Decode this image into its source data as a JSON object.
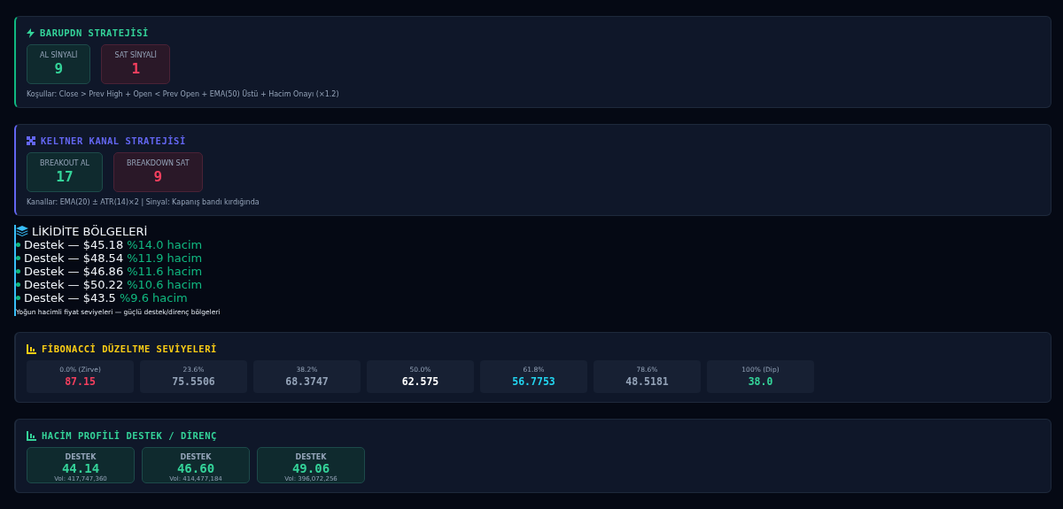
{
  "barupdn": {
    "title": "BARUPDN STRATEJİSİ",
    "signals": [
      {
        "kind": "buy",
        "label": "AL SİNYALİ",
        "value": "9"
      },
      {
        "kind": "sell",
        "label": "SAT SİNYALİ",
        "value": "1"
      }
    ],
    "note": "Koşullar: Close > Prev High + Open < Prev Open + EMA(50) Üstü + Hacim Onayı (×1.2)"
  },
  "keltner": {
    "title": "KELTNER KANAL STRATEJİSİ",
    "signals": [
      {
        "kind": "buy",
        "label": "BREAKOUT AL",
        "value": "17"
      },
      {
        "kind": "sell",
        "label": "BREAKDOWN SAT",
        "value": "9"
      }
    ],
    "note": "Kanallar: EMA(20) ± ATR(14)×2 | Sinyal: Kapanış bandı kırdığında"
  },
  "liquidity": {
    "title": "LİKİDİTE BÖLGELERİ",
    "zones": [
      {
        "label": "Destek — $45.18",
        "share": "%14.0 hacim"
      },
      {
        "label": "Destek — $48.54",
        "share": "%11.9 hacim"
      },
      {
        "label": "Destek — $46.86",
        "share": "%11.6 hacim"
      },
      {
        "label": "Destek — $50.22",
        "share": "%10.6 hacim"
      },
      {
        "label": "Destek — $43.5",
        "share": "%9.6 hacim"
      }
    ],
    "note": "Yoğun hacimli fiyat seviyeleri — güçlü destek/direnç bölgeleri"
  },
  "fibonacci": {
    "title": "FİBONACCİ DÜZELTME SEVİYELERİ",
    "levels": [
      {
        "label": "0.0% (Zirve)",
        "value": "87.15",
        "color": "#f43f5e"
      },
      {
        "label": "23.6%",
        "value": "75.5506",
        "color": "#94a3b8"
      },
      {
        "label": "38.2%",
        "value": "68.3747",
        "color": "#94a3b8"
      },
      {
        "label": "50.0%",
        "value": "62.575",
        "color": "#ffffff"
      },
      {
        "label": "61.8%",
        "value": "56.7753",
        "color": "#22d3ee"
      },
      {
        "label": "78.6%",
        "value": "48.5181",
        "color": "#94a3b8"
      },
      {
        "label": "100% (Dip)",
        "value": "38.0",
        "color": "#34d399"
      }
    ]
  },
  "volume_profile": {
    "title": "HACİM PROFİLİ DESTEK / DİRENÇ",
    "levels": [
      {
        "kind": "support",
        "label": "DESTEK",
        "value": "44.14",
        "volume": "Vol: 417,747,360"
      },
      {
        "kind": "support",
        "label": "DESTEK",
        "value": "46.60",
        "volume": "Vol: 414,477,184"
      },
      {
        "kind": "support",
        "label": "DESTEK",
        "value": "49.06",
        "volume": "Vol: 396,072,256"
      }
    ]
  }
}
